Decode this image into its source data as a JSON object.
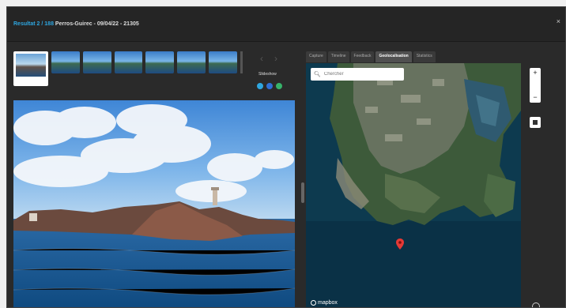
{
  "window": {
    "title_accent": "Resultat 2 / 188",
    "title_rest": " Perros-Guirec - 09/04/22 - 21305",
    "close_label": "×"
  },
  "viewer": {
    "slideshow_label": "Slideshow",
    "prev_icon": "‹",
    "next_icon": "›",
    "round_buttons": [
      {
        "name": "info",
        "color": "#2ea6e0"
      },
      {
        "name": "share",
        "color": "#2f6fd6"
      },
      {
        "name": "download",
        "color": "#37b36a"
      }
    ]
  },
  "tabs": [
    {
      "label": "Capture",
      "active": false
    },
    {
      "label": "Timeline",
      "active": false
    },
    {
      "label": "Feedback",
      "active": false
    },
    {
      "label": "Geolocalisation",
      "active": true
    },
    {
      "label": "Statistics",
      "active": false
    }
  ],
  "map": {
    "search_placeholder": "Chercher",
    "attribution": "mapbox",
    "zoom_in": "+",
    "zoom_out": "−"
  },
  "colors": {
    "accent": "#2ea6e0",
    "pin": "#e53935"
  }
}
